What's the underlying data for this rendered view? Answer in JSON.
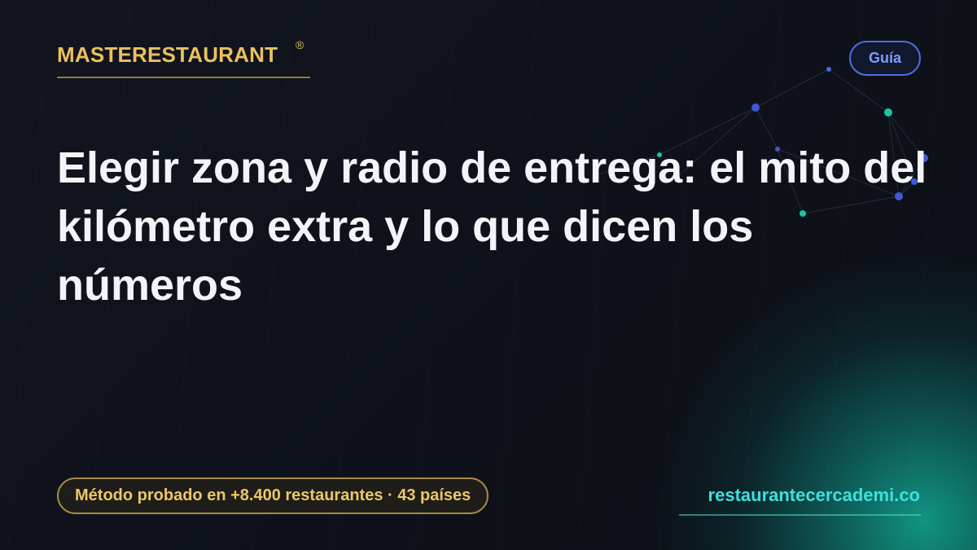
{
  "brand": {
    "name": "MASTERESTAURANT",
    "reg_mark": "®"
  },
  "badge": {
    "label": "Guía"
  },
  "headline": "Elegir zona y radio de entrega: el mito del kilómetro extra y lo que dicen los números",
  "footer": {
    "proof_text": "Método probado en +8.400 restaurantes · 43 países",
    "site": "restaurantecercademi.co"
  },
  "colors": {
    "background": "#0f121b",
    "gold": "#e9c15f",
    "badge_blue": "#4f6fe0",
    "teal": "#3fe0dc",
    "title": "#f3f4f7"
  },
  "decor": {
    "network_nodes": "network-graph"
  }
}
